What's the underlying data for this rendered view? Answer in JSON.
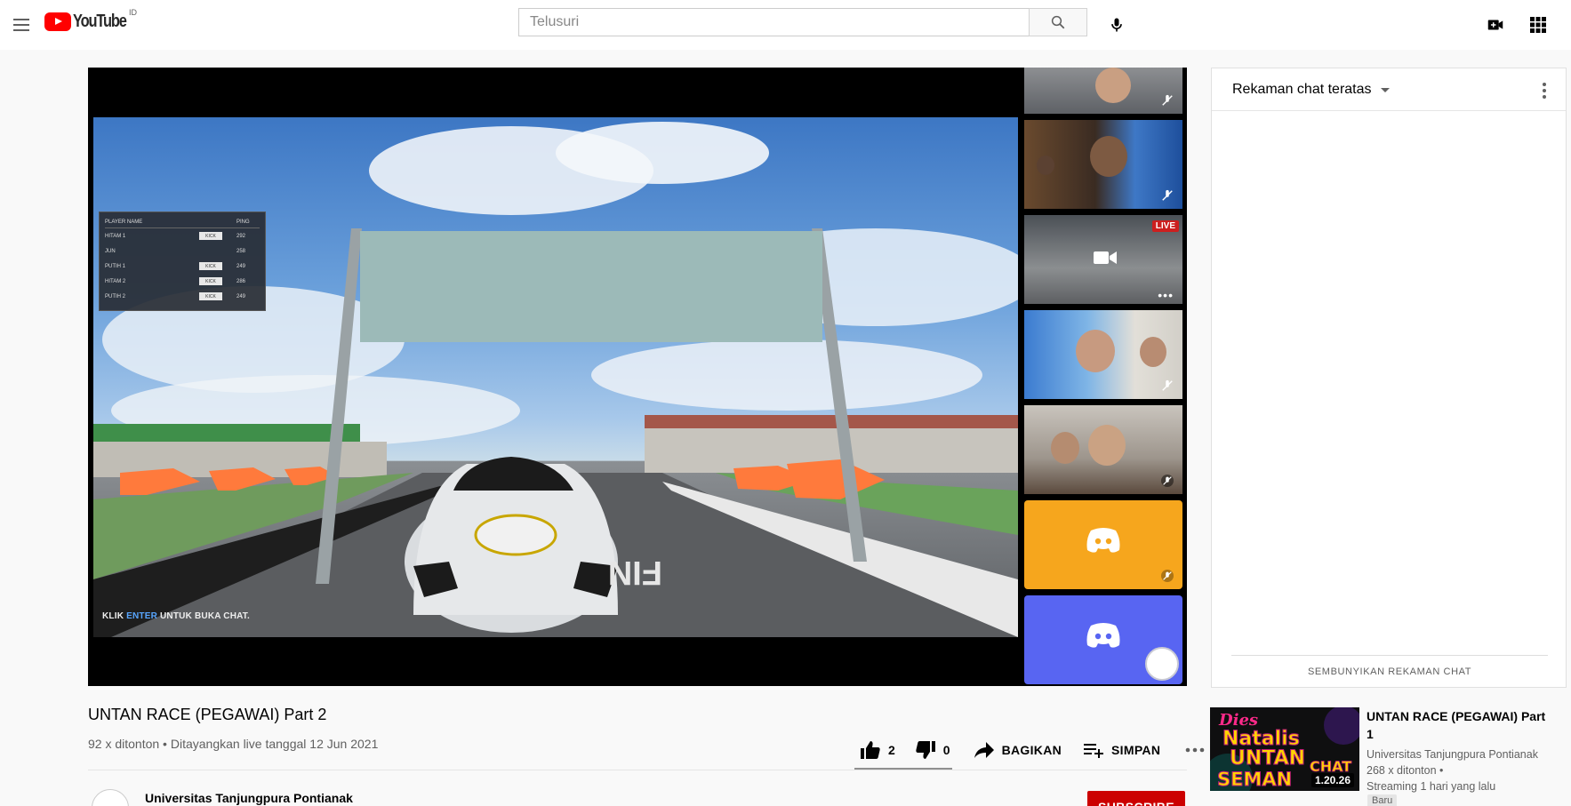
{
  "masthead": {
    "logo_text": "YouTube",
    "country_code": "ID",
    "search_placeholder": "Telusuri"
  },
  "player": {
    "scoreboard": {
      "header_name": "PLAYER NAME",
      "header_ping": "PING",
      "rows": [
        {
          "name": "HITAM 1",
          "kick": "KICK",
          "ping": "292"
        },
        {
          "name": "JUN",
          "kick": "",
          "ping": "258"
        },
        {
          "name": "PUTIH 1",
          "kick": "KICK",
          "ping": "249"
        },
        {
          "name": "HITAM 2",
          "kick": "KICK",
          "ping": "286"
        },
        {
          "name": "PUTIH 2",
          "kick": "KICK",
          "ping": "249"
        }
      ]
    },
    "hint": {
      "prefix": "KLIK",
      "key": "ENTER",
      "suffix": "UNTUK BUKA CHAT."
    },
    "live_badge": "LIVE"
  },
  "video": {
    "title": "UNTAN RACE (PEGAWAI) Part 2",
    "meta": "92 x ditonton • Ditayangkan live tanggal 12 Jun 2021",
    "likes": "2",
    "dislikes": "0",
    "share_label": "BAGIKAN",
    "save_label": "SIMPAN",
    "owner_name": "Universitas Tanjungpura Pontianak",
    "subscribe_label": "SUBSCRIBE"
  },
  "chat": {
    "header": "Rekaman chat teratas",
    "hide_label": "SEMBUNYIKAN REKAMAN CHAT"
  },
  "recommendation": {
    "title": "UNTAN RACE (PEGAWAI) Part 1",
    "channel": "Universitas Tanjungpura Pontianak",
    "views": "268 x ditonton •",
    "when": "Streaming 1 hari yang lalu",
    "badge": "Baru",
    "duration": "1.20.26",
    "thumb_text": {
      "line1": "Dies",
      "line2": "Natalis",
      "line3": "UNTAN",
      "line4": "SEMAN",
      "line5": "CHAT"
    }
  },
  "colors": {
    "brand_red": "#ff0000",
    "subscribe_red": "#cc0000",
    "discord_orange": "#f6a61d",
    "discord_blurple": "#5865f2"
  },
  "icons": [
    "menu-icon",
    "play-logo-icon",
    "search-icon",
    "mic-icon",
    "create-video-icon",
    "apps-icon",
    "mute-icon",
    "camera-icon",
    "discord-icon",
    "like-icon",
    "dislike-icon",
    "share-icon",
    "save-playlist-icon",
    "more-icon",
    "kebab-icon",
    "caret-down-icon"
  ]
}
